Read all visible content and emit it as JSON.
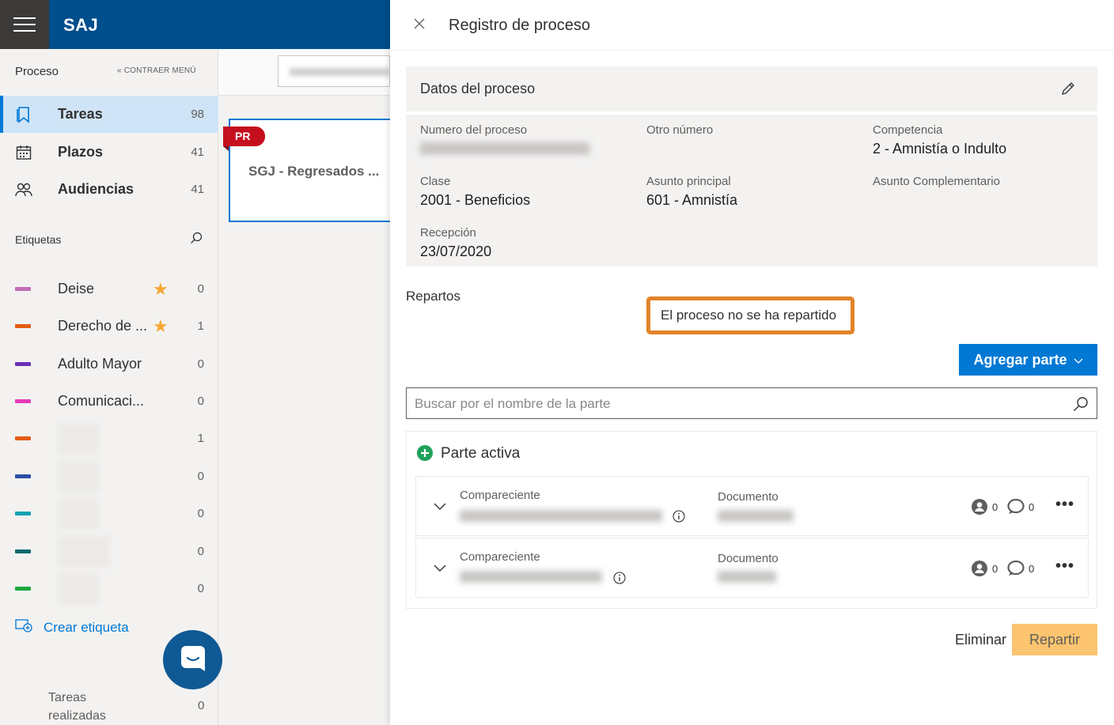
{
  "app": {
    "brand": "SAJ"
  },
  "sidebar": {
    "section_title": "Proceso",
    "collapse_label": "CONTRAER MENÚ",
    "items": [
      {
        "label": "Tareas",
        "count": "98",
        "icon": "bookmark-icon",
        "active": true
      },
      {
        "label": "Plazos",
        "count": "41",
        "icon": "calendar-icon",
        "active": false
      },
      {
        "label": "Audiencias",
        "count": "41",
        "icon": "people-icon",
        "active": false
      }
    ],
    "tags_title": "Etiquetas",
    "tags": [
      {
        "label": "Deise",
        "count": "0",
        "color": "#c06fb5",
        "starred": true
      },
      {
        "label": "Derecho de ...",
        "count": "1",
        "color": "#e45c14",
        "starred": true
      },
      {
        "label": "Adulto Mayor",
        "count": "0",
        "color": "#6b31b5",
        "starred": false
      },
      {
        "label": "Comunicaci...",
        "count": "0",
        "color": "#e83cba",
        "starred": false
      },
      {
        "label": "",
        "count": "1",
        "color": "#e45c14",
        "starred": false
      },
      {
        "label": "",
        "count": "0",
        "color": "#2c4fa6",
        "starred": false
      },
      {
        "label": "",
        "count": "0",
        "color": "#11a3b0",
        "starred": false
      },
      {
        "label": "",
        "count": "0",
        "color": "#0a6a70",
        "starred": false
      },
      {
        "label": "",
        "count": "0",
        "color": "#1ea63c",
        "starred": false
      }
    ],
    "create_tag": "Crear etiqueta",
    "done_label": "Tareas realizadas",
    "done_count": "0"
  },
  "main": {
    "card_badge": "PR",
    "card_title": "SGJ - Regresados ..."
  },
  "panel": {
    "title": "Registro de proceso",
    "datos_title": "Datos del proceso",
    "fields": {
      "numero_label": "Numero del proceso",
      "otro_label": "Otro número",
      "competencia_label": "Competencia",
      "competencia_value": "2 - Amnistía o Indulto",
      "clase_label": "Clase",
      "clase_value": "2001 - Beneficios",
      "asunto_label": "Asunto principal",
      "asunto_value": "601 - Amnistía",
      "complementario_label": "Asunto Complementario",
      "recepcion_label": "Recepción",
      "recepcion_value": "23/07/2020"
    },
    "repartos_label": "Repartos",
    "repartos_status": "El proceso no se ha repartido",
    "add_parte": "Agregar parte",
    "search_placeholder": "Buscar por el nombre de la parte",
    "parte_title": "Parte activa",
    "rows": [
      {
        "compareciente_label": "Compareciente",
        "documento_label": "Documento",
        "persons": "0",
        "comments": "0"
      },
      {
        "compareciente_label": "Compareciente",
        "documento_label": "Documento",
        "persons": "0",
        "comments": "0"
      }
    ],
    "eliminar": "Eliminar",
    "repartir": "Repartir"
  }
}
